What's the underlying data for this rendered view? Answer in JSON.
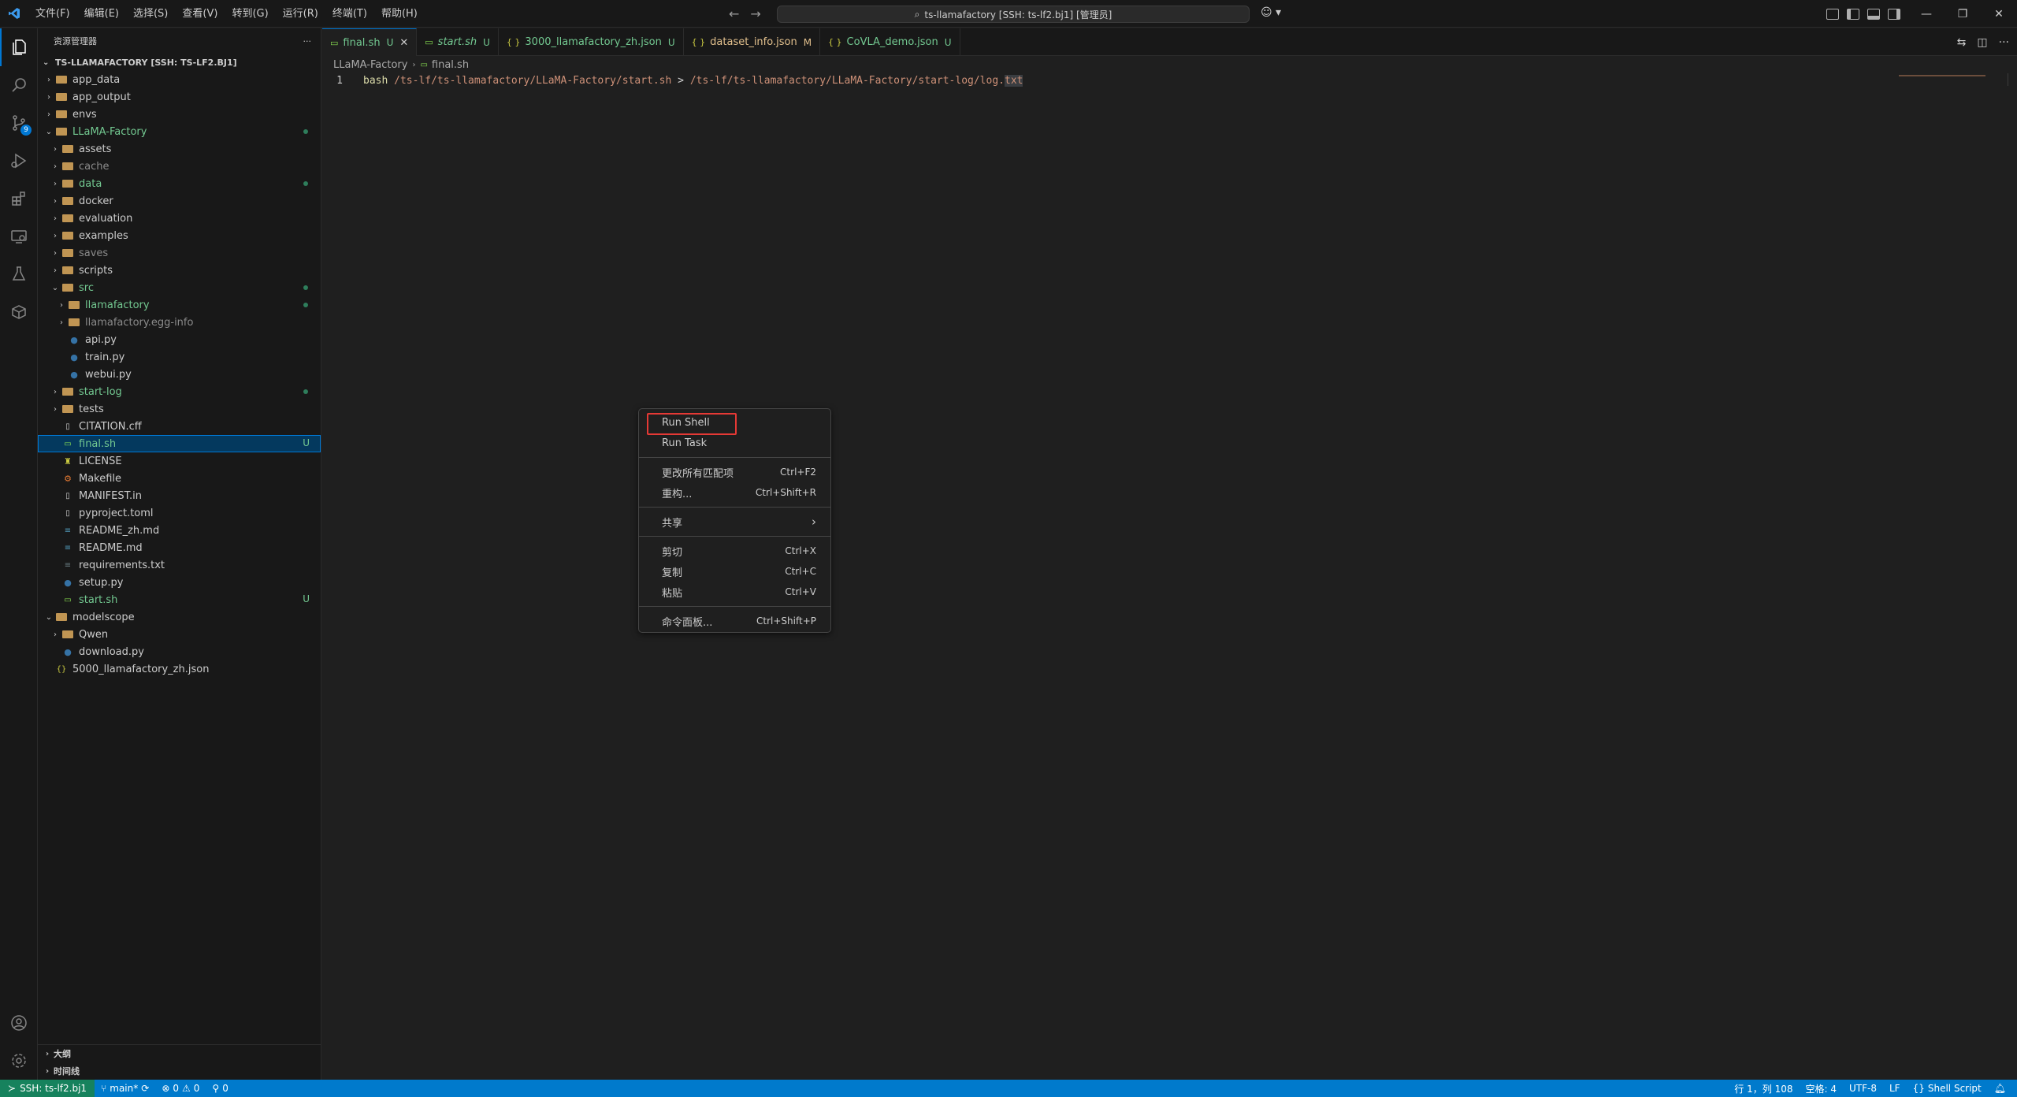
{
  "titlebar": {
    "menu": [
      "文件(F)",
      "编辑(E)",
      "选择(S)",
      "查看(V)",
      "转到(G)",
      "运行(R)",
      "终端(T)",
      "帮助(H)"
    ],
    "search": "ts-llamafactory [SSH: ts-lf2.bj1] [管理员]"
  },
  "activitybar": {
    "source_control_badge": "9"
  },
  "sidebar": {
    "title": "资源管理器",
    "more": "···",
    "root": "TS-LLAMAFACTORY [SSH: TS-LF2.BJ1]",
    "items": [
      {
        "label": "app_data",
        "indent": 0,
        "type": "folder",
        "expanded": false
      },
      {
        "label": "app_output",
        "indent": 0,
        "type": "folder",
        "expanded": false
      },
      {
        "label": "envs",
        "indent": 0,
        "type": "folder",
        "expanded": false
      },
      {
        "label": "LLaMA-Factory",
        "indent": 0,
        "type": "folder",
        "expanded": true,
        "color": "green",
        "dot": true
      },
      {
        "label": "assets",
        "indent": 1,
        "type": "folder",
        "expanded": false
      },
      {
        "label": "cache",
        "indent": 1,
        "type": "folder",
        "expanded": false,
        "color": "dim"
      },
      {
        "label": "data",
        "indent": 1,
        "type": "folder",
        "expanded": false,
        "color": "green",
        "dot": true
      },
      {
        "label": "docker",
        "indent": 1,
        "type": "folder",
        "expanded": false
      },
      {
        "label": "evaluation",
        "indent": 1,
        "type": "folder",
        "expanded": false
      },
      {
        "label": "examples",
        "indent": 1,
        "type": "folder",
        "expanded": false
      },
      {
        "label": "saves",
        "indent": 1,
        "type": "folder",
        "expanded": false,
        "color": "dim"
      },
      {
        "label": "scripts",
        "indent": 1,
        "type": "folder",
        "expanded": false
      },
      {
        "label": "src",
        "indent": 1,
        "type": "folder",
        "expanded": true,
        "color": "green",
        "dot": true
      },
      {
        "label": "llamafactory",
        "indent": 2,
        "type": "folder",
        "expanded": false,
        "color": "green",
        "dot": true
      },
      {
        "label": "llamafactory.egg-info",
        "indent": 2,
        "type": "folder",
        "expanded": false,
        "color": "dim"
      },
      {
        "label": "api.py",
        "indent": 2,
        "type": "py"
      },
      {
        "label": "train.py",
        "indent": 2,
        "type": "py"
      },
      {
        "label": "webui.py",
        "indent": 2,
        "type": "py"
      },
      {
        "label": "start-log",
        "indent": 1,
        "type": "folder",
        "expanded": false,
        "color": "green",
        "dot": true
      },
      {
        "label": "tests",
        "indent": 1,
        "type": "folder",
        "expanded": false
      },
      {
        "label": "CITATION.cff",
        "indent": 1,
        "type": "file"
      },
      {
        "label": "final.sh",
        "indent": 1,
        "type": "sh",
        "color": "green",
        "status": "U",
        "selected": true
      },
      {
        "label": "LICENSE",
        "indent": 1,
        "type": "license"
      },
      {
        "label": "Makefile",
        "indent": 1,
        "type": "make"
      },
      {
        "label": "MANIFEST.in",
        "indent": 1,
        "type": "file"
      },
      {
        "label": "pyproject.toml",
        "indent": 1,
        "type": "file"
      },
      {
        "label": "README_zh.md",
        "indent": 1,
        "type": "md"
      },
      {
        "label": "README.md",
        "indent": 1,
        "type": "md"
      },
      {
        "label": "requirements.txt",
        "indent": 1,
        "type": "txt"
      },
      {
        "label": "setup.py",
        "indent": 1,
        "type": "py"
      },
      {
        "label": "start.sh",
        "indent": 1,
        "type": "sh",
        "color": "green",
        "status": "U"
      },
      {
        "label": "modelscope",
        "indent": 0,
        "type": "folder",
        "expanded": true
      },
      {
        "label": "Qwen",
        "indent": 1,
        "type": "folder",
        "expanded": false
      },
      {
        "label": "download.py",
        "indent": 1,
        "type": "py"
      },
      {
        "label": "5000_llamafactory_zh.json",
        "indent": 0,
        "type": "json"
      }
    ],
    "outline": "大纲",
    "timeline": "时间线"
  },
  "tabs": [
    {
      "label": "final.sh",
      "status": "U",
      "active": true,
      "italic": false
    },
    {
      "label": "start.sh",
      "status": "U",
      "active": false,
      "italic": true
    },
    {
      "label": "3000_llamafactory_zh.json",
      "status": "U",
      "active": false,
      "italic": false
    },
    {
      "label": "dataset_info.json",
      "status": "M",
      "active": false,
      "italic": false
    },
    {
      "label": "CoVLA_demo.json",
      "status": "U",
      "active": false,
      "italic": false
    }
  ],
  "breadcrumb": {
    "folder": "LLaMA-Factory",
    "file": "final.sh"
  },
  "editor": {
    "line_number": "1",
    "cmd": "bash",
    "path1": "/ts-lf/ts-llamafactory/LLaMA-Factory/start.sh",
    "redirect": ">",
    "path2": "/ts-lf/ts-llamafactory/LLaMA-Factory/start-log/log.",
    "ext": "txt"
  },
  "context_menu": {
    "items": [
      {
        "label": "Run Shell",
        "key": ""
      },
      {
        "label": "Run Task",
        "key": ""
      },
      {
        "label": "更改所有匹配项",
        "key": "Ctrl+F2"
      },
      {
        "label": "重构...",
        "key": "Ctrl+Shift+R"
      },
      {
        "label": "共享",
        "key": "›"
      },
      {
        "label": "剪切",
        "key": "Ctrl+X"
      },
      {
        "label": "复制",
        "key": "Ctrl+C"
      },
      {
        "label": "粘贴",
        "key": "Ctrl+V"
      },
      {
        "label": "命令面板...",
        "key": "Ctrl+Shift+P"
      }
    ]
  },
  "statusbar": {
    "remote": "SSH: ts-lf2.bj1",
    "branch": "main*",
    "errors": "0",
    "warnings": "0",
    "ports": "0",
    "position": "行 1，列 108",
    "spaces": "空格: 4",
    "encoding": "UTF-8",
    "eol": "LF",
    "language": "Shell Script"
  },
  "colors": {
    "accent": "#0078d4",
    "statusbar": "#007acc",
    "remote": "#16825d",
    "git_untracked": "#73c991",
    "highlight_box": "#e53935"
  }
}
